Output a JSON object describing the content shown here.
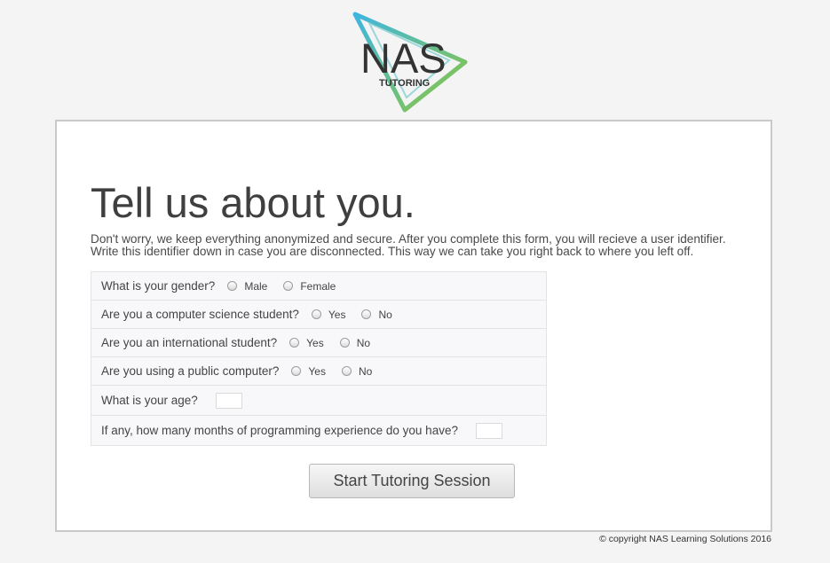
{
  "brand": {
    "name": "NAS",
    "tagline": "TUTORING"
  },
  "colors": {
    "triangle_blue": "#3fb6e0",
    "triangle_green": "#8cc63f",
    "logo_text": "#333333",
    "panel_border": "#c9c9c9"
  },
  "form": {
    "heading": "Tell us about you.",
    "intro_line1": "Don't worry, we keep everything anonymized and secure. After you complete this form, you will recieve a user identifier.",
    "intro_line2": "Write this identifier down in case you are disconnected. This way we can take you right back to where you left off.",
    "questions": [
      {
        "label": "What is your gender?",
        "options": [
          "Male",
          "Female"
        ]
      },
      {
        "label": "Are you a computer science student?",
        "options": [
          "Yes",
          "No"
        ]
      },
      {
        "label": "Are you an international student?",
        "options": [
          "Yes",
          "No"
        ]
      },
      {
        "label": "Are you using a public computer?",
        "options": [
          "Yes",
          "No"
        ]
      },
      {
        "label": "What is your age?",
        "value": ""
      },
      {
        "label": "If any, how many months of programming experience do you have?",
        "value": ""
      }
    ],
    "submit_label": "Start Tutoring Session"
  },
  "footer": {
    "copyright": "© copyright NAS Learning Solutions 2016"
  }
}
